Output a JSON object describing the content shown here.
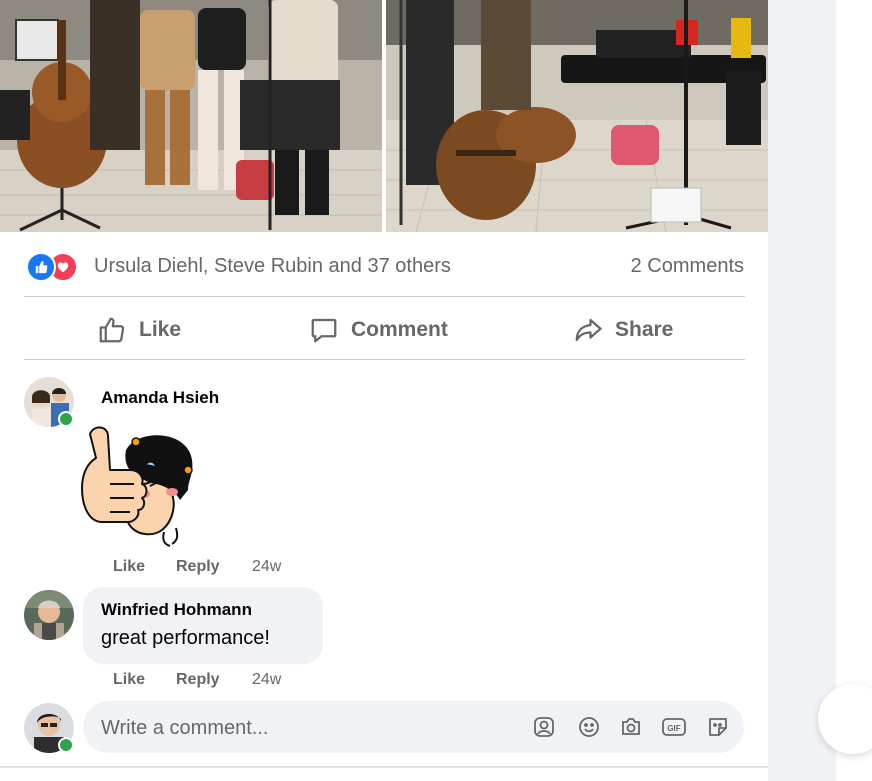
{
  "post": {
    "reactions": {
      "icons": [
        "like-reaction-icon",
        "love-reaction-icon"
      ],
      "names": "Ursula Diehl, Steve Rubin and 37 others",
      "comments_count": "2 Comments"
    },
    "actions": {
      "like": "Like",
      "comment": "Comment",
      "share": "Share"
    }
  },
  "comments": [
    {
      "author": "Amanda Hsieh",
      "sticker": "thumbs-up-girl-sticker",
      "like": "Like",
      "reply": "Reply",
      "time": "24w"
    },
    {
      "author": "Winfried Hohmann",
      "text": "great performance!",
      "like": "Like",
      "reply": "Reply",
      "time": "24w"
    }
  ],
  "composer": {
    "placeholder": "Write a comment...",
    "tools": [
      "avatar-sticker-icon",
      "emoji-icon",
      "camera-icon",
      "gif-icon",
      "sticker-icon"
    ]
  },
  "colors": {
    "brand_blue": "#1877f2",
    "love_red": "#f33e58",
    "secondary_text": "#65676b",
    "bubble_bg": "#f0f2f5",
    "online_green": "#31a24c"
  }
}
